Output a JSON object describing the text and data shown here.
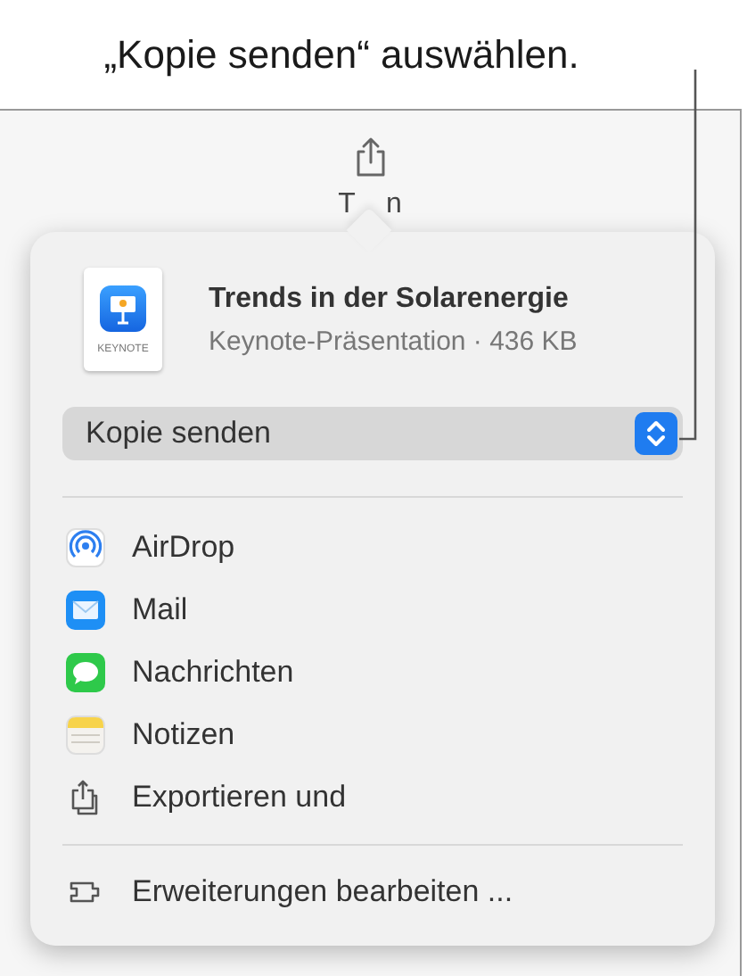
{
  "callout": "„Kopie senden“ auswählen.",
  "toolbar": {
    "label_fragments": [
      "T",
      "n"
    ]
  },
  "file": {
    "title": "Trends in der Solarenergie",
    "subtitle": "Keynote-Präsentation · 436 KB",
    "icon_label": "KEYNOTE"
  },
  "dropdown": {
    "value": "Kopie senden"
  },
  "share_items": [
    {
      "kind": "airdrop",
      "label": "AirDrop"
    },
    {
      "kind": "mail",
      "label": "Mail"
    },
    {
      "kind": "messages",
      "label": "Nachrichten"
    },
    {
      "kind": "notes",
      "label": "Notizen"
    },
    {
      "kind": "export",
      "label": "Exportieren und"
    }
  ],
  "footer_item": {
    "label": "Erweiterungen bearbeiten ..."
  }
}
